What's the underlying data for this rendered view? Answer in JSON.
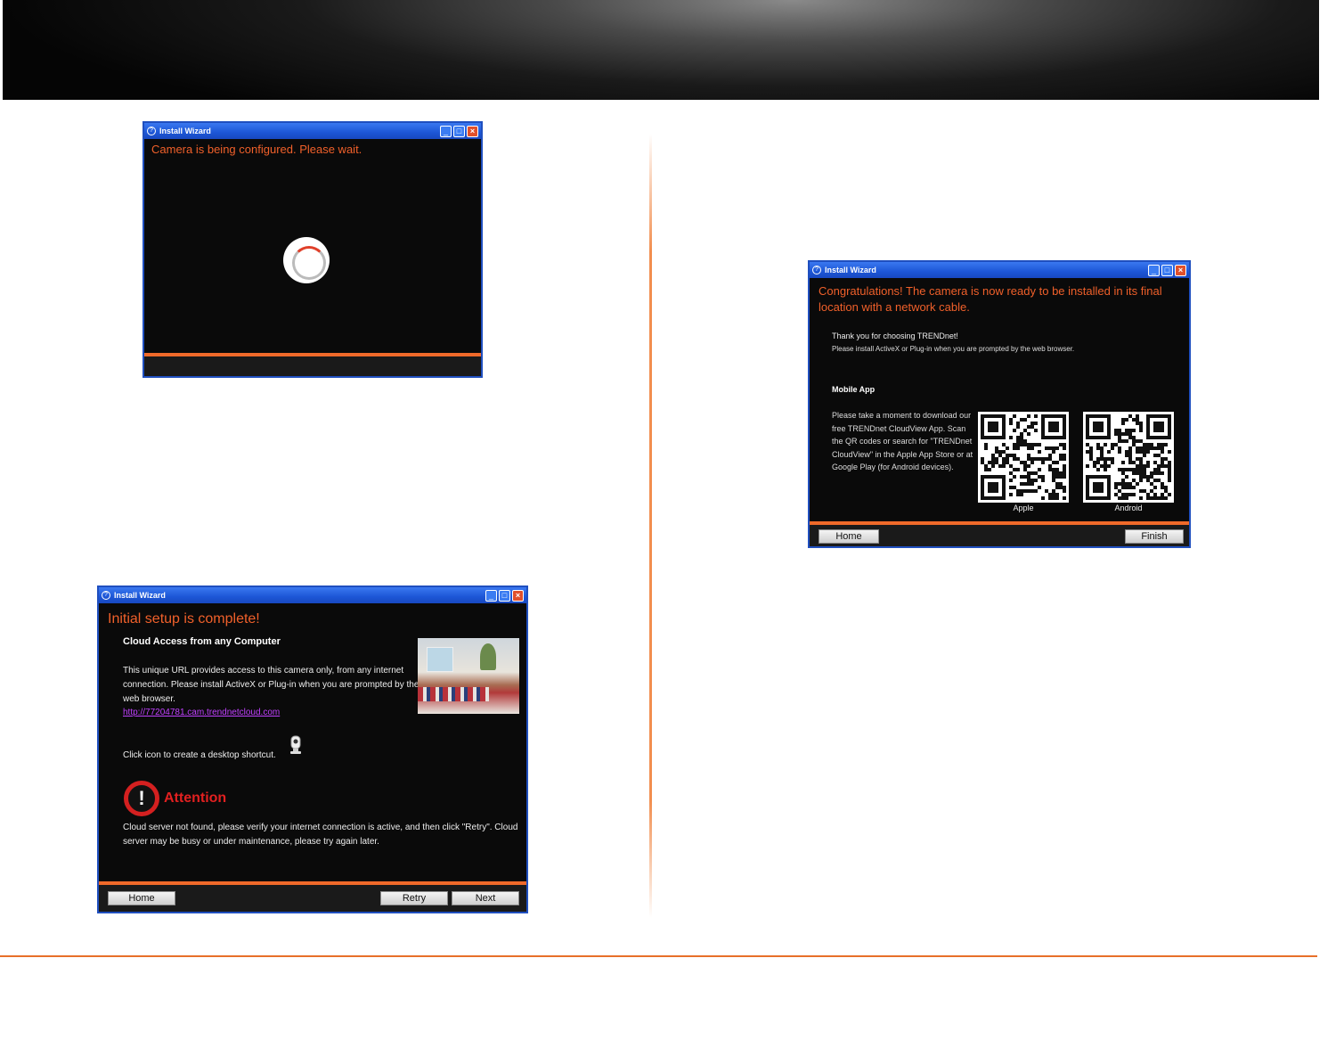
{
  "window1": {
    "title": "Install Wizard",
    "message": "Camera is being configured. Please wait."
  },
  "window2": {
    "title": "Install Wizard",
    "heading": "Initial setup is complete!",
    "subheading": "Cloud Access from any Computer",
    "description": "This unique URL provides access to this camera only, from any internet connection. Please install ActiveX or Plug-in when you are prompted by the web browser.",
    "url": "http://77204781.cam.trendnetcloud.com",
    "shortcut_text": "Click icon to create a desktop shortcut.",
    "attention": "Attention",
    "warning": "Cloud server not found, please verify your internet connection is active, and then click \"Retry\". Cloud server may be busy or under maintenance, please try again later.",
    "buttons": {
      "home": "Home",
      "retry": "Retry",
      "next": "Next"
    }
  },
  "window3": {
    "title": "Install Wizard",
    "congrats": "Congratulations! The camera is now ready to be installed in its final location with a network cable.",
    "thank_you": "Thank you for choosing TRENDnet!",
    "install_note": "Please install ActiveX or Plug-in when you are prompted by the web browser.",
    "mobile_heading": "Mobile App",
    "mobile_description": "Please take a moment to download our free TRENDnet CloudView App. Scan the QR codes or search for \"TRENDnet CloudView\" in the Apple App Store or at Google Play (for Android devices).",
    "qr_labels": {
      "apple": "Apple",
      "android": "Android"
    },
    "buttons": {
      "home": "Home",
      "finish": "Finish"
    }
  },
  "colors": {
    "accent": "#f06a2a",
    "titlebar": "#1c56d6",
    "attention": "#e22020",
    "link": "#c040ff"
  }
}
